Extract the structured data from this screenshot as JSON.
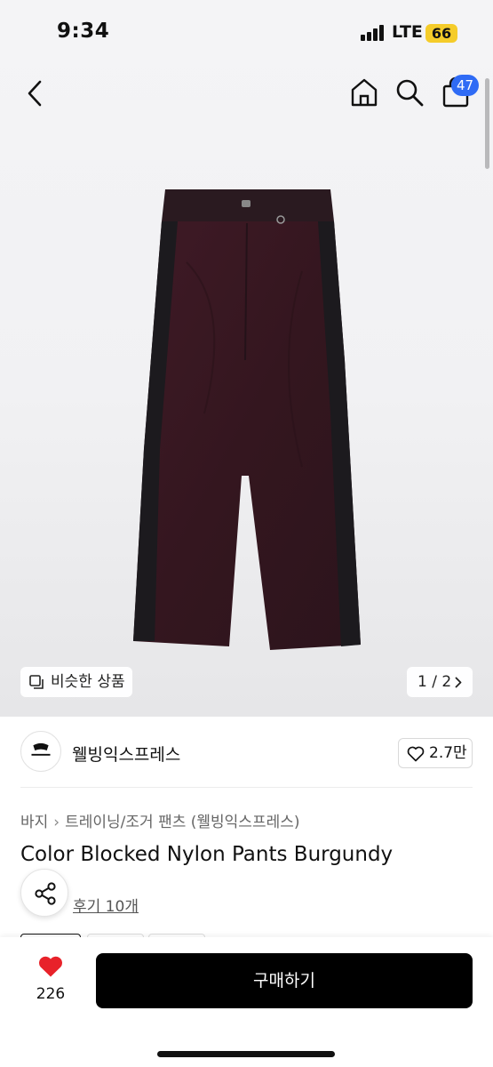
{
  "status_bar": {
    "time": "9:34",
    "network": "LTE",
    "battery": "66"
  },
  "nav": {
    "cart_count": "47"
  },
  "image_area": {
    "similar_label": "비슷한 상품",
    "page_indicator": "1 / 2"
  },
  "seller": {
    "name": "웰빙익스프레스",
    "likes": "2.7만"
  },
  "breadcrumb": {
    "level1": "바지",
    "level2": "트레이닝/조거 팬츠 (웰빙익스프레스)"
  },
  "product": {
    "title": "Color Blocked Nylon Pants Burgundy",
    "review_link": "후기 10개"
  },
  "bottom_bar": {
    "like_count": "226",
    "buy_label": "구매하기"
  },
  "colors": {
    "accent_blue": "#2f6bf5",
    "like_red": "#e8222a",
    "battery_yellow": "#f5cc2a",
    "buy_black": "#000000",
    "pants_burgundy": "#3a1c26"
  }
}
